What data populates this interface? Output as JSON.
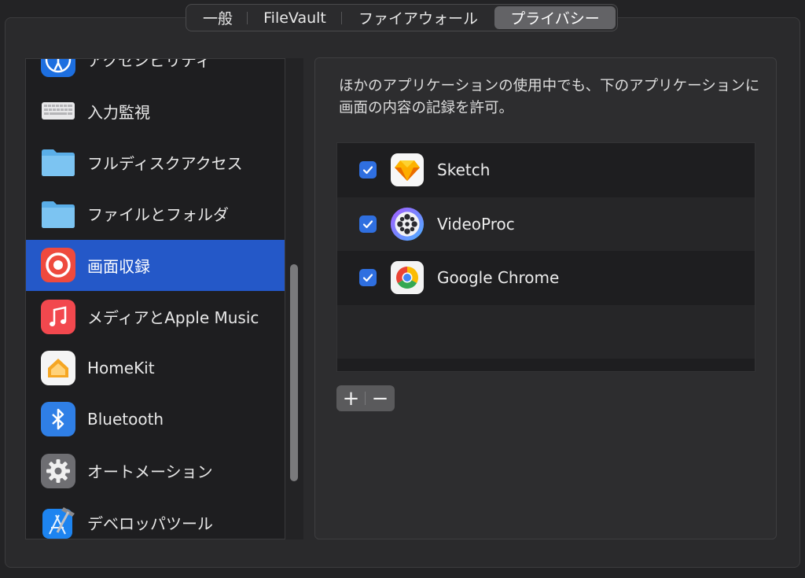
{
  "tabs": [
    {
      "label": "一般",
      "active": false
    },
    {
      "label": "FileVault",
      "active": false
    },
    {
      "label": "ファイアウォール",
      "active": false
    },
    {
      "label": "プライバシー",
      "active": true
    }
  ],
  "sidebar": {
    "items": [
      {
        "label": "アクセシビリティ",
        "icon": "accessibility-icon"
      },
      {
        "label": "入力監視",
        "icon": "keyboard-icon"
      },
      {
        "label": "フルディスクアクセス",
        "icon": "folder-icon"
      },
      {
        "label": "ファイルとフォルダ",
        "icon": "folder-icon"
      },
      {
        "label": "画面収録",
        "icon": "screen-recording-icon",
        "selected": true
      },
      {
        "label": "メディアとApple Music",
        "icon": "music-icon"
      },
      {
        "label": "HomeKit",
        "icon": "home-icon"
      },
      {
        "label": "Bluetooth",
        "icon": "bluetooth-icon"
      },
      {
        "label": "オートメーション",
        "icon": "gear-icon"
      },
      {
        "label": "デベロッパツール",
        "icon": "xcode-icon"
      }
    ]
  },
  "detail": {
    "description": "ほかのアプリケーションの使用中でも、下のアプリケーションに画面の内容の記録を許可。",
    "apps": [
      {
        "name": "Sketch",
        "checked": true,
        "icon": "sketch-icon"
      },
      {
        "name": "VideoProc",
        "checked": true,
        "icon": "videoproc-icon"
      },
      {
        "name": "Google Chrome",
        "checked": true,
        "icon": "chrome-icon"
      }
    ],
    "add_label": "+",
    "remove_label": "−"
  },
  "colors": {
    "accent": "#2458c8",
    "checkbox": "#2f6fe0",
    "background": "#232325"
  }
}
